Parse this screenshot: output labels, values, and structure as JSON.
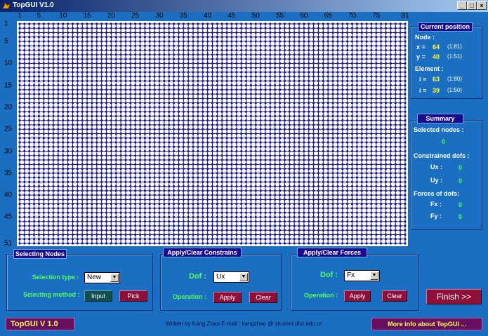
{
  "window": {
    "title": "TopGUI V1.0",
    "controls": {
      "minimize": "_",
      "maximize": "□",
      "close": "×"
    }
  },
  "plot": {
    "x_ticks": [
      "1",
      "5",
      "10",
      "15",
      "20",
      "25",
      "30",
      "35",
      "40",
      "45",
      "50",
      "55",
      "60",
      "65",
      "70",
      "75",
      "81"
    ],
    "y_ticks": [
      "1",
      "5",
      "10",
      "15",
      "20",
      "25",
      "30",
      "35",
      "40",
      "45",
      "51"
    ],
    "node_cols": 81,
    "node_rows": 51,
    "node_color": "#1a1a8c",
    "background_color": "#ffffff"
  },
  "current_position": {
    "title": "Current position",
    "node_label": "Node :",
    "x_label": "x =",
    "x_value": "64",
    "x_range": "(1:81)",
    "y_label": "y =",
    "y_value": "40",
    "y_range": "(1:51)",
    "element_label": "Element :",
    "i_label": "i =",
    "i_value": "63",
    "i_range": "(1:80)",
    "j_label": "i =",
    "j_value": "39",
    "j_range": "(1:50)"
  },
  "summary": {
    "title": "Summary",
    "selected_nodes_label": "Selected  nodes :",
    "selected_nodes_value": "0",
    "constrained_label": "Constrained dofs :",
    "ux_label": "Ux :",
    "ux_value": "0",
    "uy_label": "Uy :",
    "uy_value": "0",
    "forces_label": "Forces of dofs:",
    "fx_label": "Fx :",
    "fx_value": "0",
    "fy_label": "Fy :",
    "fy_value": "0"
  },
  "selecting_nodes": {
    "title": "Selecting Nodes",
    "selection_type_label": "Selection type :",
    "selection_type_value": "New",
    "selecting_method_label": "Selecting method :",
    "input_button": "Input",
    "pick_button": "Pick"
  },
  "constrains": {
    "title": "Apply/Clear Constrains",
    "dof_label": "Dof :",
    "dof_value": "Ux",
    "operation_label": "Operation :",
    "apply_button": "Apply",
    "clear_button": "Clear"
  },
  "forces": {
    "title": "Apply/Clear Forces",
    "dof_label": "Dof :",
    "dof_value": "Fx",
    "operation_label": "Operation :",
    "apply_button": "Apply",
    "clear_button": "Clear"
  },
  "finish_button": "Finish >>",
  "footer": {
    "brand": "TopGUI  V 1.0",
    "credit": "Written by Kang Zhao   E-mail : kangzhao @ student.dlut.edu.cn",
    "more_info_button": "More info about TopGUI ..."
  }
}
